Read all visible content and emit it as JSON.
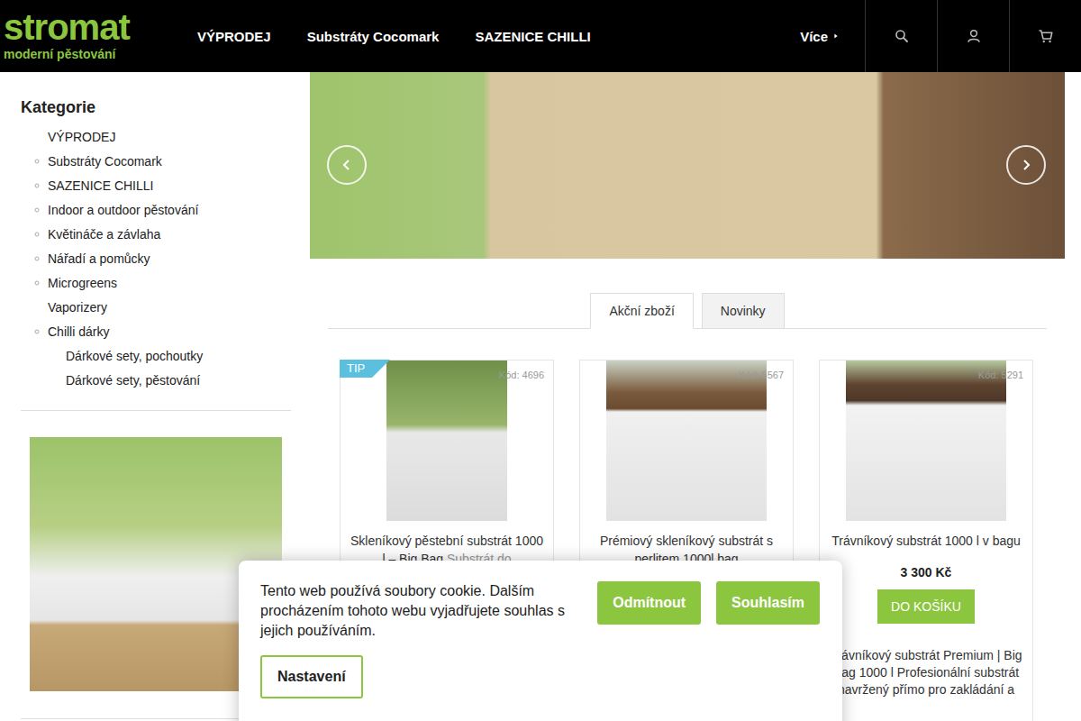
{
  "header": {
    "logo": {
      "wordmark": "stromat",
      "tagline": "moderní pěstování"
    },
    "nav": [
      {
        "label": "VÝPRODEJ"
      },
      {
        "label": "Substráty Cocomark"
      },
      {
        "label": "SAZENICE CHILLI"
      }
    ],
    "more": {
      "label": "Více"
    }
  },
  "sidebar": {
    "title": "Kategorie",
    "items": [
      {
        "label": "VÝPRODEJ",
        "kind": "top",
        "has_submenu": false
      },
      {
        "label": "Substráty Cocomark",
        "kind": "top",
        "has_submenu": true
      },
      {
        "label": "SAZENICE CHILLI",
        "kind": "top",
        "has_submenu": true
      },
      {
        "label": "Indoor a outdoor pěstování",
        "kind": "top",
        "has_submenu": true
      },
      {
        "label": "Květináče a závlaha",
        "kind": "top",
        "has_submenu": true
      },
      {
        "label": "Nářadí a pomůcky",
        "kind": "top",
        "has_submenu": true
      },
      {
        "label": "Microgreens",
        "kind": "top",
        "has_submenu": true
      },
      {
        "label": "Vaporizery",
        "kind": "top",
        "has_submenu": false
      },
      {
        "label": "Chilli dárky",
        "kind": "top",
        "has_submenu": true
      },
      {
        "label": "Dárkové sety, pochoutky",
        "kind": "sub",
        "has_submenu": false
      },
      {
        "label": "Dárkové sety, pěstování",
        "kind": "sub",
        "has_submenu": false
      }
    ]
  },
  "tabs": [
    {
      "label": "Akční zboží",
      "selected": true
    },
    {
      "label": "Novinky",
      "selected": false
    }
  ],
  "products": [
    {
      "badge": "TIP",
      "code": "Kód: 4696",
      "title": "Skleníkový pěstební substrát 1000 l – Big Bag",
      "note": "Substrát do"
    },
    {
      "code": "Kód: 5567",
      "title": "Prémiový skleníkový substrát s perlitem 1000l bag"
    },
    {
      "code": "Kód: 5291",
      "title": "Trávníkový substrát 1000 l v bagu",
      "price": "3 300 Kč",
      "button": "DO KOŠÍKU",
      "description": "Trávníkový substrát Premium | Big Bag 1000 l Profesionální substrát navržený přímo pro zakládání a"
    }
  ],
  "cookie": {
    "text": "Tento web používá soubory cookie. Dalším procházením tohoto webu vyjadřujete souhlas s jejich používáním.",
    "buttons": [
      {
        "label": "Odmítnout",
        "kind": "primary"
      },
      {
        "label": "Souhlasím",
        "kind": "primary"
      },
      {
        "label": "Nastavení",
        "kind": "outline"
      }
    ]
  }
}
